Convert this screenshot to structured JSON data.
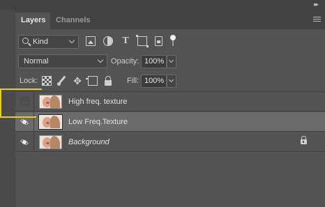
{
  "panel": {
    "tabs": [
      {
        "label": "Layers",
        "active": true
      },
      {
        "label": "Channels",
        "active": false
      }
    ]
  },
  "filter": {
    "kind_label": "Kind",
    "icons": [
      "image-filter-icon",
      "adjustment-filter-icon",
      "type-filter-icon",
      "shape-filter-icon",
      "smart-object-filter-icon",
      "filter-toggle-icon"
    ]
  },
  "blend": {
    "mode": "Normal",
    "opacity_label": "Opacity:",
    "opacity_value": "100%"
  },
  "lock": {
    "label": "Lock:",
    "fill_label": "Fill:",
    "fill_value": "100%"
  },
  "layers": [
    {
      "name": "High freq. texture",
      "visible": false,
      "selected": false,
      "locked": false
    },
    {
      "name": "Low Freq.Texture",
      "visible": true,
      "selected": true,
      "locked": false
    },
    {
      "name": "Background",
      "visible": true,
      "selected": false,
      "locked": true
    }
  ],
  "colors": {
    "panel_bg": "#535353",
    "tab_bar_bg": "#424242",
    "selected_layer_bg": "#6b6b6b",
    "annotation": "#e8d300"
  }
}
